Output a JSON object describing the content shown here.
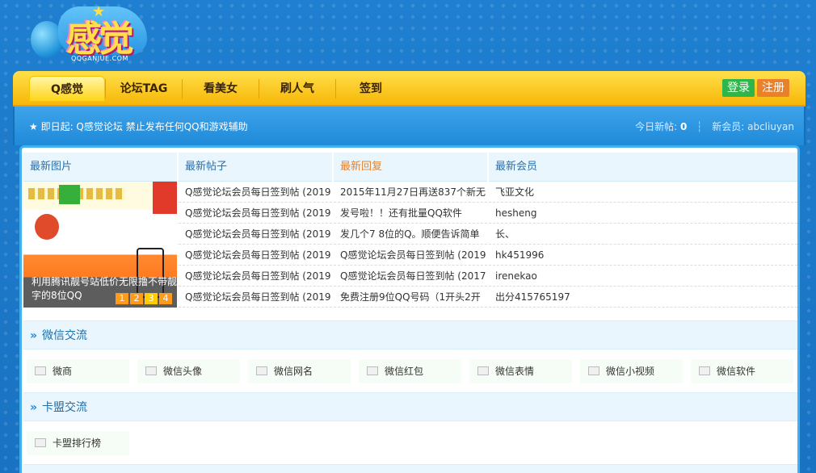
{
  "logo": {
    "text": "感觉",
    "domain": "QQGANJUE.COM"
  },
  "nav": {
    "items": [
      "Q感觉",
      "论坛TAG",
      "看美女",
      "刷人气",
      "签到"
    ],
    "login": "登录",
    "register": "注册"
  },
  "notice": {
    "text": "★ 即日起:   Q感觉论坛 禁止发布任何QQ和游戏辅助",
    "today_label": "今日新帖:",
    "today_count": "0",
    "new_member_label": "新会员:",
    "new_member": "abcliuyan"
  },
  "columns": {
    "pics": "最新图片",
    "posts": "最新帖子",
    "replies": "最新回复",
    "members": "最新会员"
  },
  "slider": {
    "caption": "利用腾讯靓号站低价无限撸不带靓字的8位QQ",
    "nums": [
      "1",
      "2",
      "3",
      "4"
    ]
  },
  "posts": [
    "Q感觉论坛会员每日签到帖 (2019",
    "Q感觉论坛会员每日签到帖 (2019",
    "Q感觉论坛会员每日签到帖 (2019",
    "Q感觉论坛会员每日签到帖 (2019",
    "Q感觉论坛会员每日签到帖 (2019",
    "Q感觉论坛会员每日签到帖 (2019"
  ],
  "replies": [
    "2015年11月27日再送837个新无",
    "发号啦！！还有批量QQ软件",
    "发几个7 8位的Q。顺便告诉简单",
    "Q感觉论坛会员每日签到帖 (2019",
    "Q感觉论坛会员每日签到帖 (2017",
    "免费注册9位QQ号码（1开头2开"
  ],
  "members": [
    "飞亚文化",
    "hesheng",
    "长、",
    "hk451996",
    "irenekao",
    "出分415765197"
  ],
  "sections": [
    {
      "title": "微信交流",
      "forums": [
        "微商",
        "微信头像",
        "微信网名",
        "微信红包",
        "微信表情",
        "微信小视频",
        "微信软件"
      ]
    },
    {
      "title": "卡盟交流",
      "forums": [
        "卡盟排行榜"
      ]
    }
  ],
  "colors": {
    "accent": "#1f8ad9",
    "nav": "#ffd51a",
    "login": "#2fb54a",
    "register": "#e8812a",
    "reply_head": "#e8812a"
  }
}
